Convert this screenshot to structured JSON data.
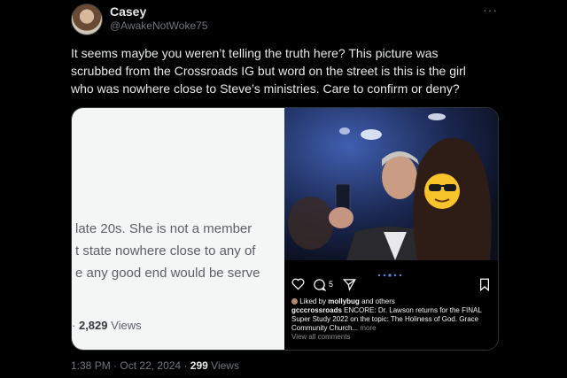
{
  "tweet": {
    "author_name": "Casey",
    "author_handle": "@AwakeNotWoke75",
    "more_menu": "···",
    "text": "It seems maybe you weren’t telling the truth here? This picture was scrubbed from the Crossroads IG but word on the street is this is the girl who was nowhere close to Steve’s ministries. Care to confirm or deny?",
    "time": "1:38 PM",
    "separator": "·",
    "date": "Oct 22, 2024",
    "views_count": "299",
    "views_label": "Views"
  },
  "embedded_left": {
    "lines": [
      "late 20s. She is not a member",
      "t state nowhere close to any of",
      "e any good end would be serve"
    ],
    "views_prefix": "·",
    "views_count": "2,829",
    "views_label": "Views"
  },
  "embedded_instagram": {
    "comment_count": "5",
    "liked_prefix": "Liked by",
    "liked_user": "mollybug",
    "liked_suffix": "and others",
    "account": "gcccrossroads",
    "caption": "ENCORE: Dr. Lawson returns for the FINAL Super Study 2022 on the topic: The Holiness of God. Grace Community Church...",
    "more_label": "more",
    "view_comments": "View all comments"
  },
  "colors": {
    "background": "#000000",
    "text_primary": "#e7e9ea",
    "text_secondary": "#71767b",
    "emoji_yellow": "#f7c52b"
  },
  "icons": [
    "heart-icon",
    "comment-icon",
    "share-icon",
    "bookmark-icon",
    "sunglasses-emoji-icon",
    "more-icon"
  ]
}
